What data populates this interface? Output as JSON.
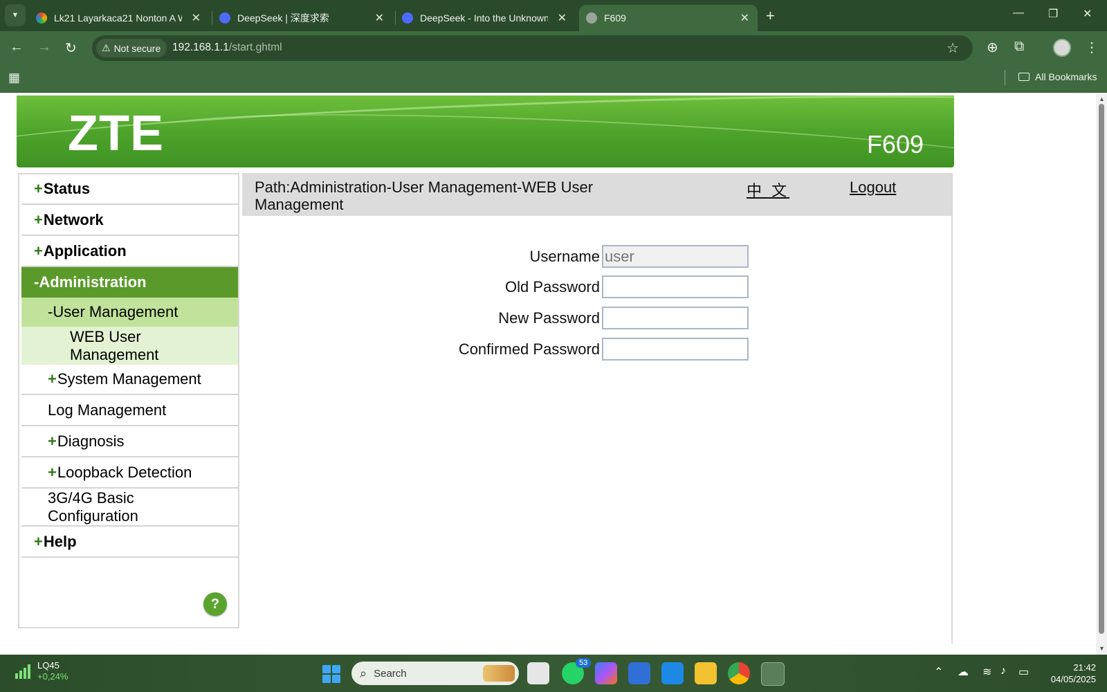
{
  "browser": {
    "tabs": [
      {
        "title": "Lk21 Layarkaca21 Nonton A Wo",
        "favicon_color": "#e24b2a"
      },
      {
        "title": "DeepSeek | 深度求索",
        "favicon_color": "#4d6bfe"
      },
      {
        "title": "DeepSeek - Into the Unknown",
        "favicon_color": "#4d6bfe"
      },
      {
        "title": "F609",
        "favicon_color": "#9aa59a"
      }
    ],
    "security_label": "Not secure",
    "url_host": "192.168.1.1",
    "url_path": "/start.ghtml",
    "all_bookmarks": "All Bookmarks"
  },
  "router": {
    "brand": "ZTE",
    "model": "F609",
    "menu": {
      "status": "Status",
      "network": "Network",
      "application": "Application",
      "administration": "Administration",
      "user_management": "User Management",
      "web_user_management_1": "WEB User",
      "web_user_management_2": "Management",
      "system_management": "System Management",
      "log_management": "Log Management",
      "diagnosis": "Diagnosis",
      "loopback_detection": "Loopback Detection",
      "basic_config_1": "3G/4G Basic",
      "basic_config_2": "Configuration",
      "help": "Help",
      "plus": "+",
      "minus": "-"
    },
    "help_glyph": "?",
    "path": "Path:Administration-User Management-WEB User Management",
    "language_link": "中 文",
    "logout": "Logout",
    "form": {
      "username_label": "Username",
      "username_value": "user",
      "old_password_label": "Old Password",
      "new_password_label": "New Password",
      "confirmed_password_label": "Confirmed Password"
    }
  },
  "taskbar": {
    "stock_name": "LQ45",
    "stock_change": "+0,24%",
    "search_placeholder": "Search",
    "whatsapp_badge": "53",
    "time": "21:42",
    "date": "04/05/2025"
  },
  "colors": {
    "browser_frame": "#3f6a3f",
    "zte_green": "#4ea42b",
    "menu_active": "#5a9a2a",
    "submenu_active": "#c0e29a",
    "leaf_active": "#e2f2d2"
  }
}
